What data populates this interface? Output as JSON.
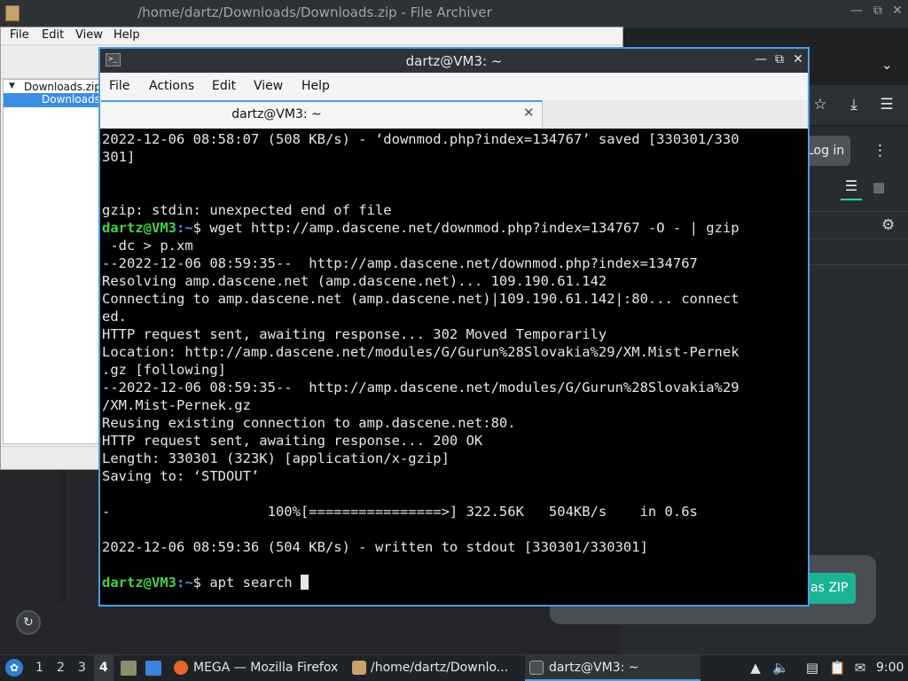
{
  "archiver": {
    "title": "/home/dartz/Downloads/Downloads.zip - File Archiver",
    "menu": [
      "File",
      "Edit",
      "View",
      "Help"
    ],
    "tree_root": "Downloads.zip",
    "tree_child": "Downloads"
  },
  "firefox": {
    "login_label": "Log in",
    "zip_button_label": "as ZIP"
  },
  "terminal": {
    "title": "dartz@VM3: ~",
    "menu": [
      "File",
      "Actions",
      "Edit",
      "View",
      "Help"
    ],
    "tab_label": "dartz@VM3: ~",
    "prompt_user": "dartz@VM3",
    "prompt_path": ":~",
    "prompt_sign": "$",
    "lines": [
      "2022-12-06 08:58:07 (508 KB/s) - ‘downmod.php?index=134767’ saved [330301/330",
      "301]",
      "",
      "",
      "gzip: stdin: unexpected end of file",
      "",
      " -dc > p.xm",
      "--2022-12-06 08:59:35--  http://amp.dascene.net/downmod.php?index=134767",
      "Resolving amp.dascene.net (amp.dascene.net)... 109.190.61.142",
      "Connecting to amp.dascene.net (amp.dascene.net)|109.190.61.142|:80... connect",
      "ed.",
      "HTTP request sent, awaiting response... 302 Moved Temporarily",
      "Location: http://amp.dascene.net/modules/G/Gurun%28Slovakia%29/XM.Mist-Pernek",
      ".gz [following]",
      "--2022-12-06 08:59:35--  http://amp.dascene.net/modules/G/Gurun%28Slovakia%29",
      "/XM.Mist-Pernek.gz",
      "Reusing existing connection to amp.dascene.net:80.",
      "HTTP request sent, awaiting response... 200 OK",
      "Length: 330301 (323K) [application/x-gzip]",
      "Saving to: ‘STDOUT’",
      "",
      "-                   100%[================>] 322.56K   504KB/s    in 0.6s",
      "",
      "2022-12-06 08:59:36 (504 KB/s) - written to stdout [330301/330301]",
      ""
    ],
    "cmd1": " wget http://amp.dascene.net/downmod.php?index=134767 -O - | gzip",
    "cmd2": " apt search "
  },
  "taskbar": {
    "workspaces": [
      "1",
      "2",
      "3",
      "4"
    ],
    "active_workspace": "4",
    "tasks": [
      {
        "label": "MEGA — Mozilla Firefox"
      },
      {
        "label": "/home/dartz/Downlo..."
      },
      {
        "label": "dartz@VM3: ~"
      }
    ],
    "clock": "9:00"
  },
  "colors": {
    "terminal_border": "#4a9fe8",
    "prompt_user": "#45d14a",
    "prompt_path": "#4a8ff0",
    "zip_button": "#1ab393"
  }
}
